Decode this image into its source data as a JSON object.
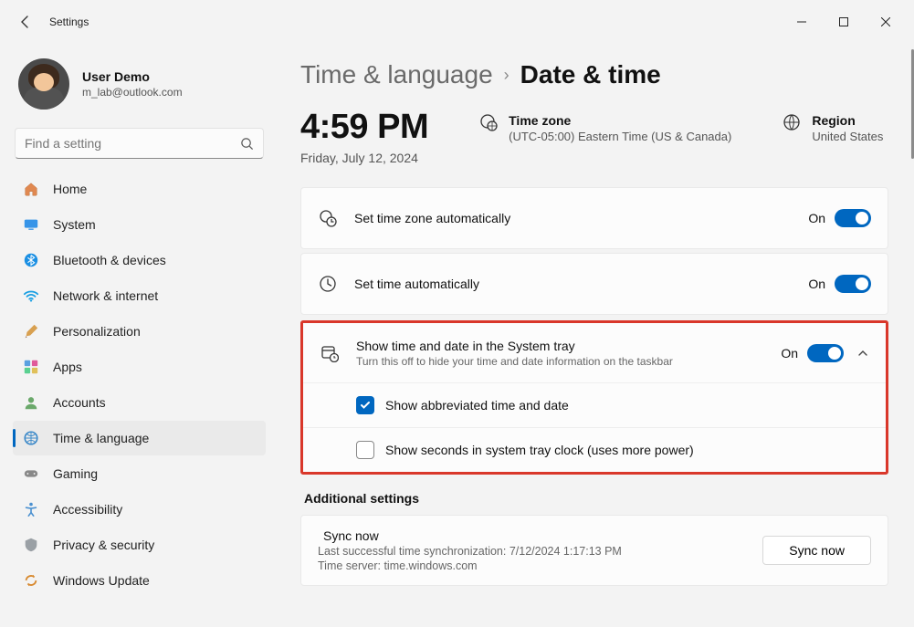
{
  "window": {
    "title": "Settings"
  },
  "user": {
    "name": "User Demo",
    "email": "m_lab@outlook.com"
  },
  "search": {
    "placeholder": "Find a setting"
  },
  "nav": {
    "items": [
      {
        "label": "Home"
      },
      {
        "label": "System"
      },
      {
        "label": "Bluetooth & devices"
      },
      {
        "label": "Network & internet"
      },
      {
        "label": "Personalization"
      },
      {
        "label": "Apps"
      },
      {
        "label": "Accounts"
      },
      {
        "label": "Time & language"
      },
      {
        "label": "Gaming"
      },
      {
        "label": "Accessibility"
      },
      {
        "label": "Privacy & security"
      },
      {
        "label": "Windows Update"
      }
    ]
  },
  "breadcrumb": {
    "parent": "Time & language",
    "current": "Date & time"
  },
  "clock": {
    "time": "4:59 PM",
    "date": "Friday, July 12, 2024"
  },
  "timezone": {
    "label": "Time zone",
    "value": "(UTC-05:00) Eastern Time (US & Canada)"
  },
  "region": {
    "label": "Region",
    "value": "United States"
  },
  "settings": {
    "autoTimezone": {
      "title": "Set time zone automatically",
      "state": "On"
    },
    "autoTime": {
      "title": "Set time automatically",
      "state": "On"
    },
    "systray": {
      "title": "Show time and date in the System tray",
      "desc": "Turn this off to hide your time and date information on the taskbar",
      "state": "On",
      "opt1": "Show abbreviated time and date",
      "opt2": "Show seconds in system tray clock (uses more power)"
    }
  },
  "additional": {
    "header": "Additional settings",
    "sync": {
      "title": "Sync now",
      "lastSync": "Last successful time synchronization: 7/12/2024 1:17:13 PM",
      "server": "Time server: time.windows.com",
      "button": "Sync now"
    }
  }
}
